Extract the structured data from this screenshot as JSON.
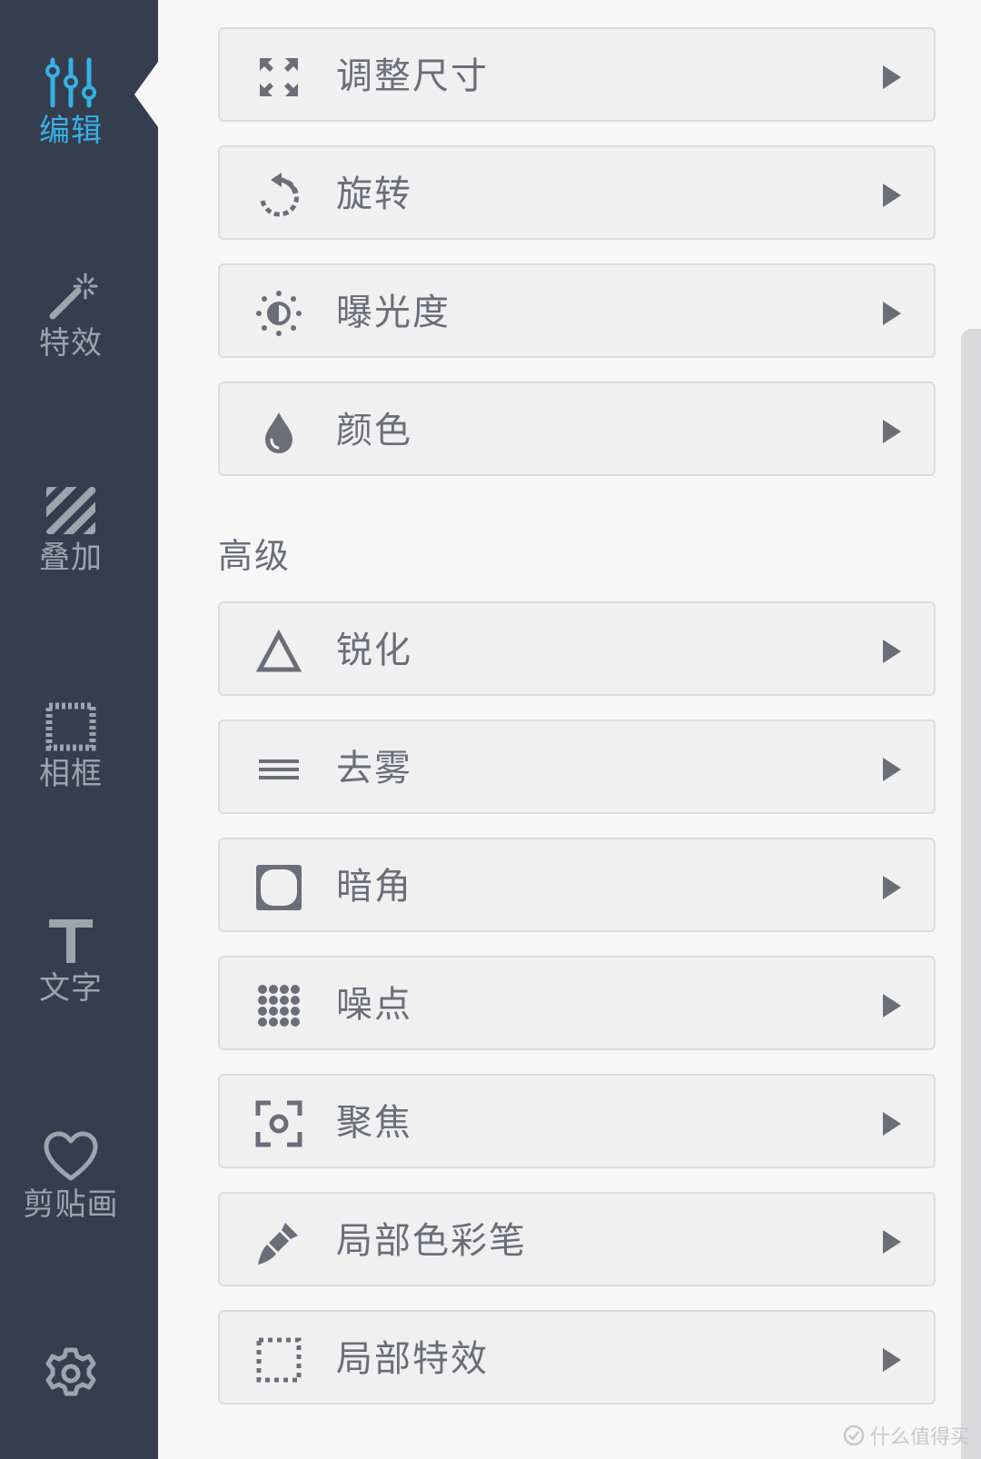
{
  "sidebar": {
    "items": [
      {
        "label": "编辑",
        "icon": "sliders-icon",
        "active": true
      },
      {
        "label": "特效",
        "icon": "magic-wand-icon",
        "active": false
      },
      {
        "label": "叠加",
        "icon": "stripes-icon",
        "active": false
      },
      {
        "label": "相框",
        "icon": "frame-icon",
        "active": false
      },
      {
        "label": "文字",
        "icon": "text-icon",
        "active": false
      },
      {
        "label": "剪贴画",
        "icon": "heart-icon",
        "active": false
      },
      {
        "label": "",
        "icon": "gear-icon",
        "active": false
      }
    ]
  },
  "main": {
    "basic_tools": [
      {
        "label": "调整尺寸",
        "icon": "resize-icon"
      },
      {
        "label": "旋转",
        "icon": "rotate-icon"
      },
      {
        "label": "曝光度",
        "icon": "brightness-icon"
      },
      {
        "label": "颜色",
        "icon": "droplet-icon"
      }
    ],
    "advanced_title": "高级",
    "advanced_tools": [
      {
        "label": "锐化",
        "icon": "triangle-icon"
      },
      {
        "label": "去雾",
        "icon": "lines-icon"
      },
      {
        "label": "暗角",
        "icon": "vignette-icon"
      },
      {
        "label": "噪点",
        "icon": "dots-grid-icon"
      },
      {
        "label": "聚焦",
        "icon": "focus-icon"
      },
      {
        "label": "局部色彩笔",
        "icon": "brush-icon"
      },
      {
        "label": "局部特效",
        "icon": "dashed-square-icon"
      }
    ]
  },
  "watermark": {
    "text": "什么值得买"
  },
  "colors": {
    "sidebar_bg": "#343e4f",
    "accent": "#38b0e3",
    "inactive": "#9ea4ad",
    "row_bg": "#f0f0f1",
    "text": "#6b6e78"
  }
}
